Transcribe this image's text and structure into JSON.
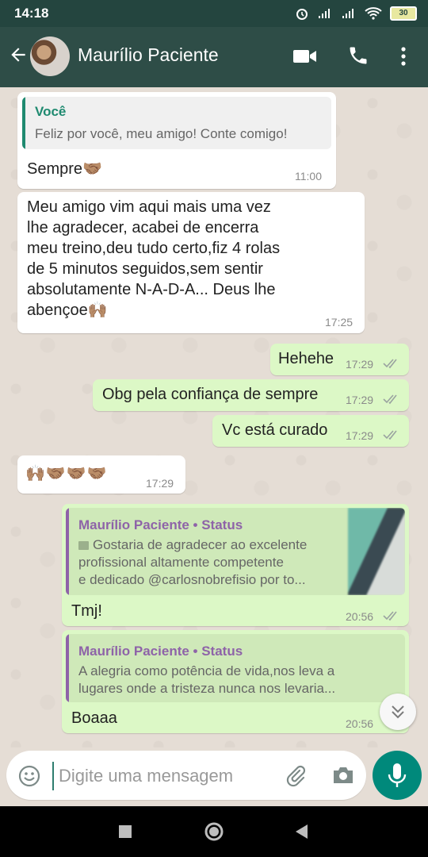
{
  "status_bar": {
    "time": "14:18",
    "battery": "30"
  },
  "header": {
    "contact_name": "Maurílio Paciente"
  },
  "messages": [
    {
      "quote_author": "Você",
      "quote_text": "Feliz por você, meu amigo! Conte comigo!",
      "text": "Sempre",
      "emoji": "🤝🏽",
      "time": "11:00",
      "direction": "in"
    },
    {
      "lines": [
        "Meu amigo vim aqui mais uma vez",
        "lhe agradecer, acabei de encerra",
        "meu treino,deu tudo certo,fiz 4 rolas",
        "de 5 minutos seguidos,sem sentir",
        "absolutamente N-A-D-A... Deus lhe"
      ],
      "last_line": "abençoe",
      "emoji": "🙌🏽",
      "time": "17:25",
      "direction": "in"
    },
    {
      "text": "Hehehe",
      "time": "17:29",
      "direction": "out"
    },
    {
      "text": "Obg pela confiança de sempre",
      "time": "17:29",
      "direction": "out"
    },
    {
      "text": "Vc está curado",
      "time": "17:29",
      "direction": "out"
    },
    {
      "emoji": "🙌🏽🤝🏽🤝🏽🤝🏽",
      "time": "17:29",
      "direction": "in"
    },
    {
      "quote_author": "Maurílio Paciente • Status",
      "quote_lines": [
        "Gostaria de agradecer ao excelente",
        "profissional altamente competente",
        "e dedicado @carlosnobrefisio por to..."
      ],
      "text": "Tmj!",
      "time": "20:56",
      "direction": "out"
    },
    {
      "quote_author": "Maurílio Paciente • Status",
      "quote_lines": [
        "A alegria como potência de vida,nos leva a",
        "lugares onde a tristeza nunca nos levaria..."
      ],
      "text": "Boaaa",
      "time": "20:56",
      "direction": "out"
    }
  ],
  "input": {
    "placeholder": "Digite uma mensagem"
  },
  "colors": {
    "header": "#2e4d47",
    "outgoing_bubble": "#dcf8c6",
    "accent": "#00897b",
    "quote_you": "#1f8a70",
    "quote_status": "#8e63a8"
  }
}
